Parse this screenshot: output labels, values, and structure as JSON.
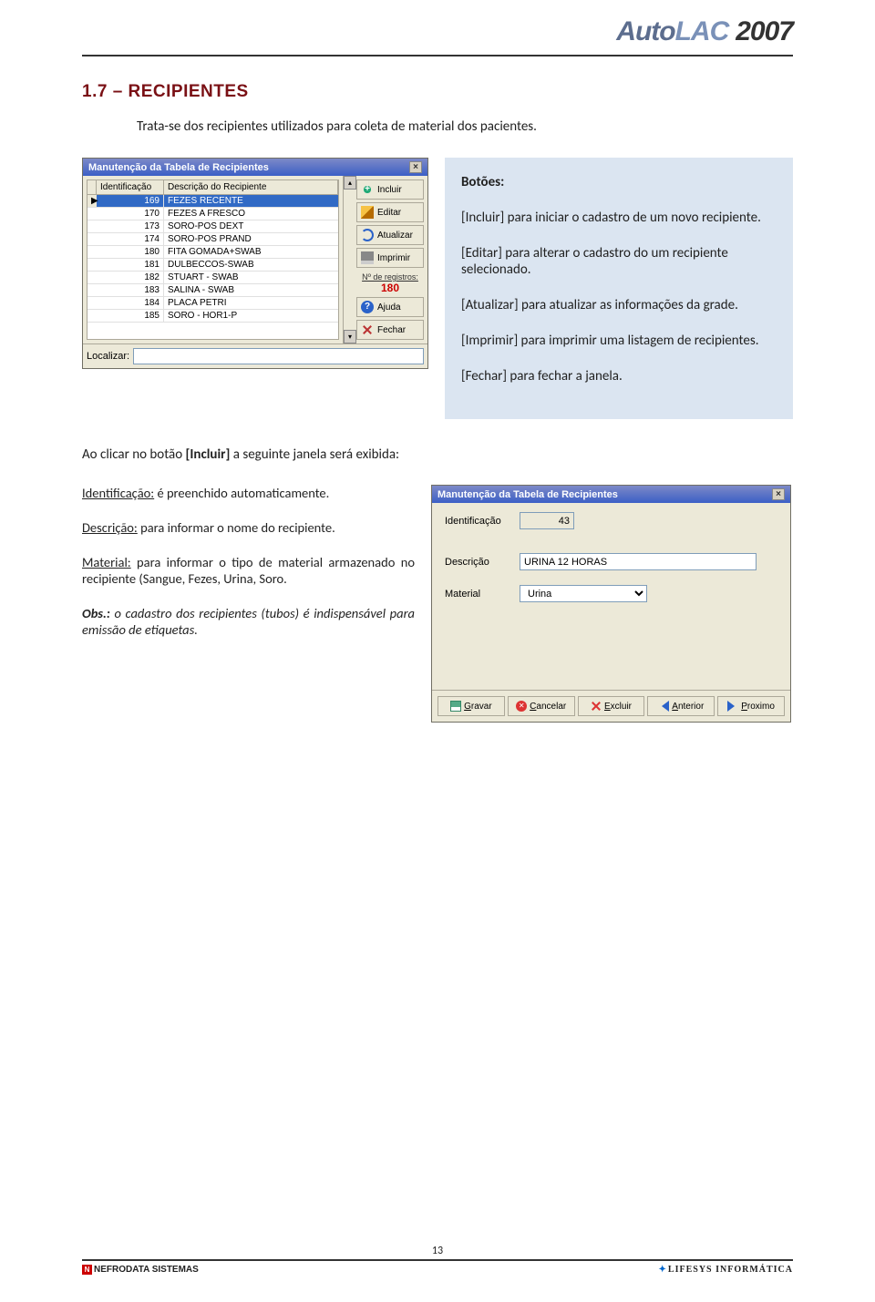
{
  "brand": {
    "auto": "Auto",
    "lac": "LAC",
    "year": "2007"
  },
  "section_title": "1.7 – RECIPIENTES",
  "intro": "Trata-se dos recipientes utilizados para coleta de material dos pacientes.",
  "win1": {
    "title": "Manutenção da Tabela de Recipientes",
    "col_id": "Identificação",
    "col_desc": "Descrição do Recipiente",
    "rows": [
      {
        "id": "169",
        "desc": "FEZES RECENTE",
        "selected": true
      },
      {
        "id": "170",
        "desc": "FEZES A FRESCO"
      },
      {
        "id": "173",
        "desc": "SORO-POS DEXT"
      },
      {
        "id": "174",
        "desc": "SORO-POS PRAND"
      },
      {
        "id": "180",
        "desc": "FITA GOMADA+SWAB"
      },
      {
        "id": "181",
        "desc": "DULBECCOS-SWAB"
      },
      {
        "id": "182",
        "desc": "STUART - SWAB"
      },
      {
        "id": "183",
        "desc": "SALINA - SWAB"
      },
      {
        "id": "184",
        "desc": "PLACA PETRI"
      },
      {
        "id": "185",
        "desc": "SORO - HOR1-P"
      }
    ],
    "buttons": {
      "incluir": "Incluir",
      "editar": "Editar",
      "atualizar": "Atualizar",
      "imprimir": "Imprimir",
      "ajuda": "Ajuda",
      "fechar": "Fechar"
    },
    "reg_label": "Nº de registros:",
    "reg_count": "180",
    "localizar_label": "Localizar:"
  },
  "callout": {
    "title": "Botões:",
    "incluir": "[Incluir] para iniciar o cadastro de um novo recipiente.",
    "editar": "[Editar] para alterar o cadastro do um recipiente selecionado.",
    "atualizar": "[Atualizar] para atualizar as informações da grade.",
    "imprimir": "[Imprimir] para imprimir uma listagem de recipientes.",
    "fechar": "[Fechar] para fechar a janela."
  },
  "mid_text": "Ao clicar no botão [Incluir] a seguinte janela será exibida:",
  "desc": {
    "ident_label": "Identificação:",
    "ident_text": " é preenchido automaticamente.",
    "desc_label": "Descrição:",
    "desc_text": " para informar o nome do recipiente.",
    "mat_label": "Material:",
    "mat_text": " para informar o tipo de material armazenado no recipiente (Sangue, Fezes, Urina, Soro.",
    "obs_label": "Obs.:",
    "obs_text": " o cadastro dos recipientes (tubos) é indispensável para emissão de etiquetas."
  },
  "win2": {
    "title": "Manutenção da Tabela de Recipientes",
    "fields": {
      "ident_label": "Identificação",
      "ident_value": "43",
      "desc_label": "Descrição",
      "desc_value": "URINA 12 HORAS",
      "mat_label": "Material",
      "mat_value": "Urina"
    },
    "buttons": {
      "gravar": "Gravar",
      "cancelar": "Cancelar",
      "excluir": "Excluir",
      "anterior": "Anterior",
      "proximo": "Proximo"
    }
  },
  "footer": {
    "page_num": "13",
    "nefro": "NEFRODATA SISTEMAS",
    "lifesys": "LIFESYS INFORMÁTICA"
  }
}
